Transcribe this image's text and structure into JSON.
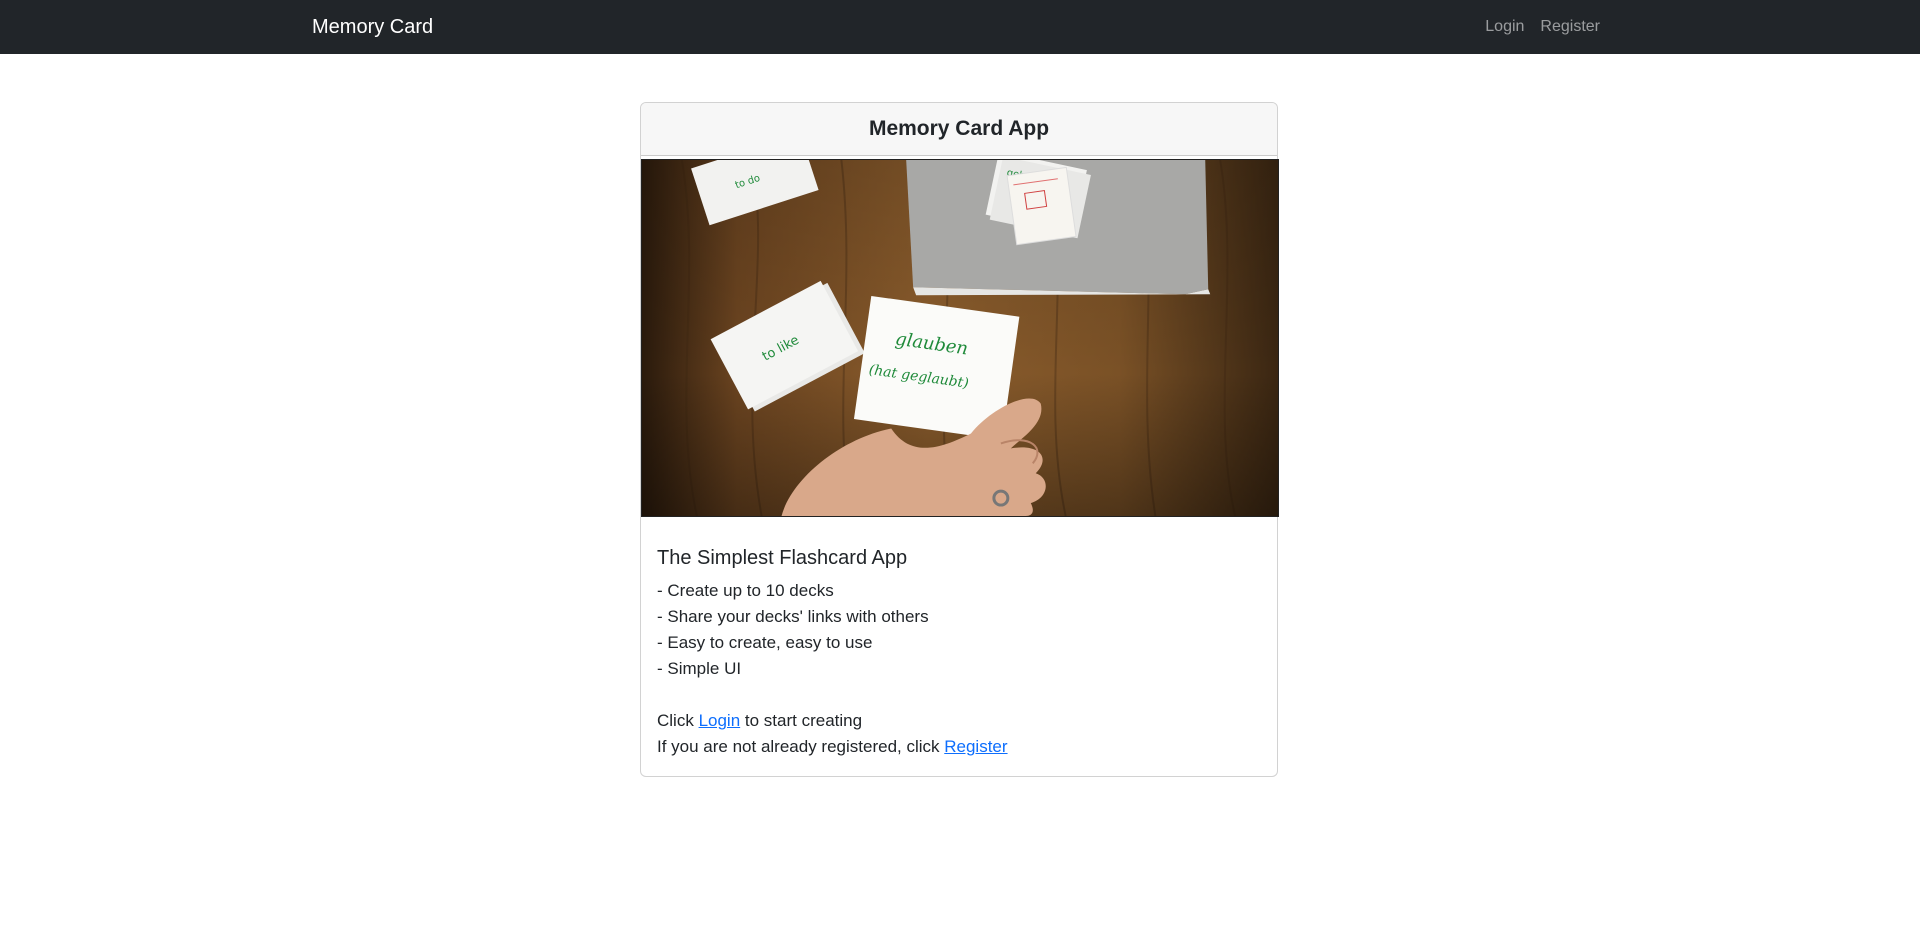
{
  "navbar": {
    "brand": "Memory Card",
    "links": [
      {
        "label": "Login"
      },
      {
        "label": "Register"
      }
    ]
  },
  "card": {
    "header": "Memory Card App",
    "image_description_icon": "flashcards-photo",
    "title": "The Simplest Flashcard App",
    "features": [
      "- Create up to 10 decks",
      "- Share your decks' links with others",
      "- Easy to create, easy to use",
      "- Simple UI"
    ],
    "login_line": {
      "prefix": "Click ",
      "link": "Login",
      "suffix": " to start creating"
    },
    "register_line": {
      "prefix": "If you are not already registered, click ",
      "link": "Register"
    },
    "image_text": {
      "card1": "to do",
      "card2": "gebracht",
      "card3": "to like",
      "card4_line1": "glauben",
      "card4_line2": "(hat geglaubt)"
    }
  },
  "colors": {
    "navbar_bg": "#212529",
    "link": "#0d6efd",
    "card_header_bg": "#f7f7f7"
  }
}
